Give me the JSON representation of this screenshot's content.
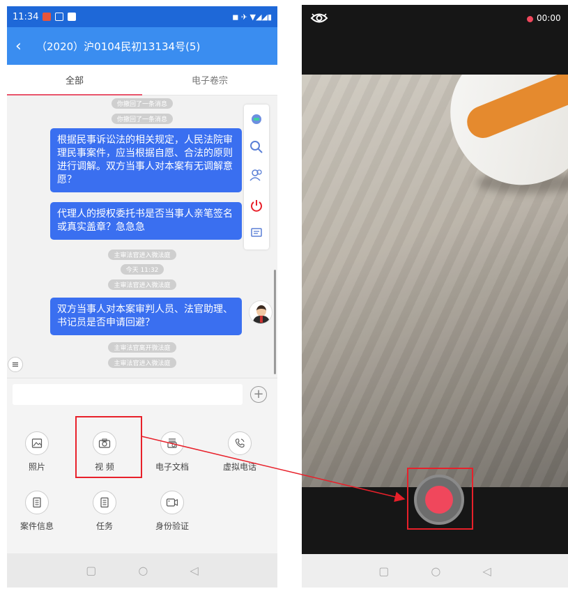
{
  "status_bar": {
    "time": "11:34",
    "icons_right": "◼ ✈ ▼◢◢▮"
  },
  "header": {
    "back_icon": "‹",
    "case_title": "（2020）沪0104民初13134号(5)"
  },
  "tabs": [
    {
      "label": "全部"
    },
    {
      "label": "电子卷宗"
    }
  ],
  "chat": {
    "system_messages": [
      "你撤回了一条消息",
      "你撤回了一条消息",
      "主审法官进入微法庭",
      "今天 11:32",
      "主审法官进入微法庭",
      "主审法官离开微法庭",
      "主审法官进入微法庭"
    ],
    "messages": [
      "根据民事诉讼法的相关规定，人民法院审理民事案件，应当根据自愿、合法的原则进行调解。双方当事人对本案有无调解意愿？",
      "代理人的授权委托书是否当事人亲笔签名或真实盖章？急急急",
      "双方当事人对本案审判人员、法官助理、书记员是否申请回避？"
    ]
  },
  "input": {
    "value": "",
    "plus_icon": "+"
  },
  "actions": [
    {
      "label": "照片",
      "icon": "image-icon"
    },
    {
      "label": "视 频",
      "icon": "camera-icon"
    },
    {
      "label": "电子文档",
      "icon": "document-icon"
    },
    {
      "label": "虚拟电话",
      "icon": "phone-icon"
    },
    {
      "label": "案件信息",
      "icon": "file-icon"
    },
    {
      "label": "任务",
      "icon": "task-icon"
    },
    {
      "label": "身份验证",
      "icon": "video-id-icon"
    }
  ],
  "camera": {
    "record_time": "00:00",
    "record_color": "#f0475c"
  },
  "colors": {
    "status_bar": "#1e68d8",
    "title_bar": "#3a8df0",
    "bubble": "#3a6ff0",
    "tab_underline": "#e9546b",
    "highlight": "#e8202a"
  }
}
